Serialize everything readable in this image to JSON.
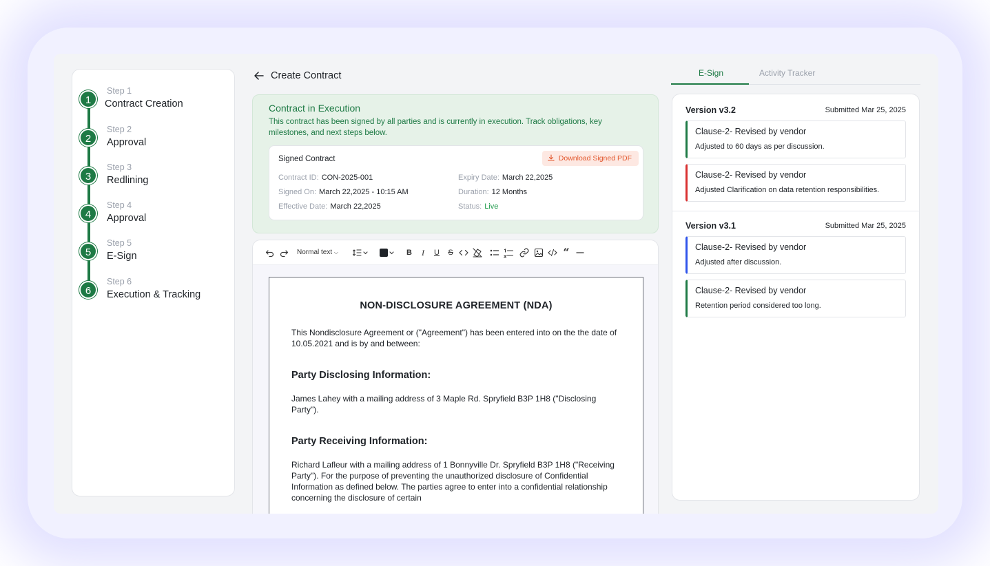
{
  "steps": [
    {
      "label": "Step 1",
      "title": "Contract Creation",
      "num": "1"
    },
    {
      "label": "Step 2",
      "title": "Approval",
      "num": "2"
    },
    {
      "label": "Step 3",
      "title": "Redlining",
      "num": "3"
    },
    {
      "label": "Step 4",
      "title": "Approval",
      "num": "4"
    },
    {
      "label": "Step 5",
      "title": "E-Sign",
      "num": "5"
    },
    {
      "label": "Step 6",
      "title": "Execution & Tracking",
      "num": "6"
    }
  ],
  "header": {
    "title": "Create Contract"
  },
  "banner": {
    "title": "Contract in Execution",
    "description": "This contract has been signed by all parties and is currently in execution. Track obligations, key milestones, and next steps below."
  },
  "signed": {
    "title": "Signed Contract",
    "download_label": "Download Signed PDF",
    "fields": {
      "contract_id": {
        "k": "Contract ID:",
        "v": "CON-2025-001"
      },
      "signed_on": {
        "k": "Signed On:",
        "v": "March 22,2025 - 10:15 AM"
      },
      "effective_date": {
        "k": "Effective Date:",
        "v": "March 22,2025"
      },
      "expiry_date": {
        "k": "Expiry Date:",
        "v": "March 22,2025"
      },
      "duration": {
        "k": "Duration:",
        "v": "12 Months"
      },
      "status": {
        "k": "Status:",
        "v": "Live"
      }
    }
  },
  "toolbar": {
    "text_style": "Normal text",
    "color": "#1f2328"
  },
  "document": {
    "title": "NON-DISCLOSURE AGREEMENT (NDA)",
    "intro": "This Nondisclosure Agreement or (\"Agreement\") has been entered into on the the date of 10.05.2021 and is by and between:",
    "h1": "Party Disclosing Information:",
    "p1": "James Lahey with a mailing address of 3 Maple Rd. Spryfield B3P 1H8 (\"Disclosing Party\").",
    "h2": "Party Receiving Information:",
    "p2": "Richard Lafleur with a mailing address of 1 Bonnyville Dr. Spryfield B3P 1H8 (\"Receiving Party\"). For the purpose of preventing the unauthorized disclosure of Confidential Information as defined below. The parties agree to enter into a confidential relationship concerning the disclosure of certain"
  },
  "tabs": {
    "esign": "E-Sign",
    "activity": "Activity Tracker"
  },
  "versions": [
    {
      "name": "Version v3.2",
      "submitted": "Submitted Mar 25, 2025",
      "clauses": [
        {
          "title": "Clause-2- Revised by vendor",
          "desc": "Adjusted to 60 days as per discussion.",
          "color": "#1e7a45"
        },
        {
          "title": "Clause-2- Revised by vendor",
          "desc": "Adjusted Clarification on data retention responsibilities.",
          "color": "#d93030"
        }
      ]
    },
    {
      "name": "Version v3.1",
      "submitted": "Submitted Mar 25, 2025",
      "clauses": [
        {
          "title": "Clause-2- Revised by vendor",
          "desc": "Adjusted after discussion.",
          "color": "#2f54eb"
        },
        {
          "title": "Clause-2- Revised by vendor",
          "desc": "Retention period considered too long.",
          "color": "#1e7a45"
        }
      ]
    }
  ],
  "colors": {
    "accent": "#1e7a45",
    "banner_bg": "#e6f2e8",
    "download": "#e2572d"
  }
}
